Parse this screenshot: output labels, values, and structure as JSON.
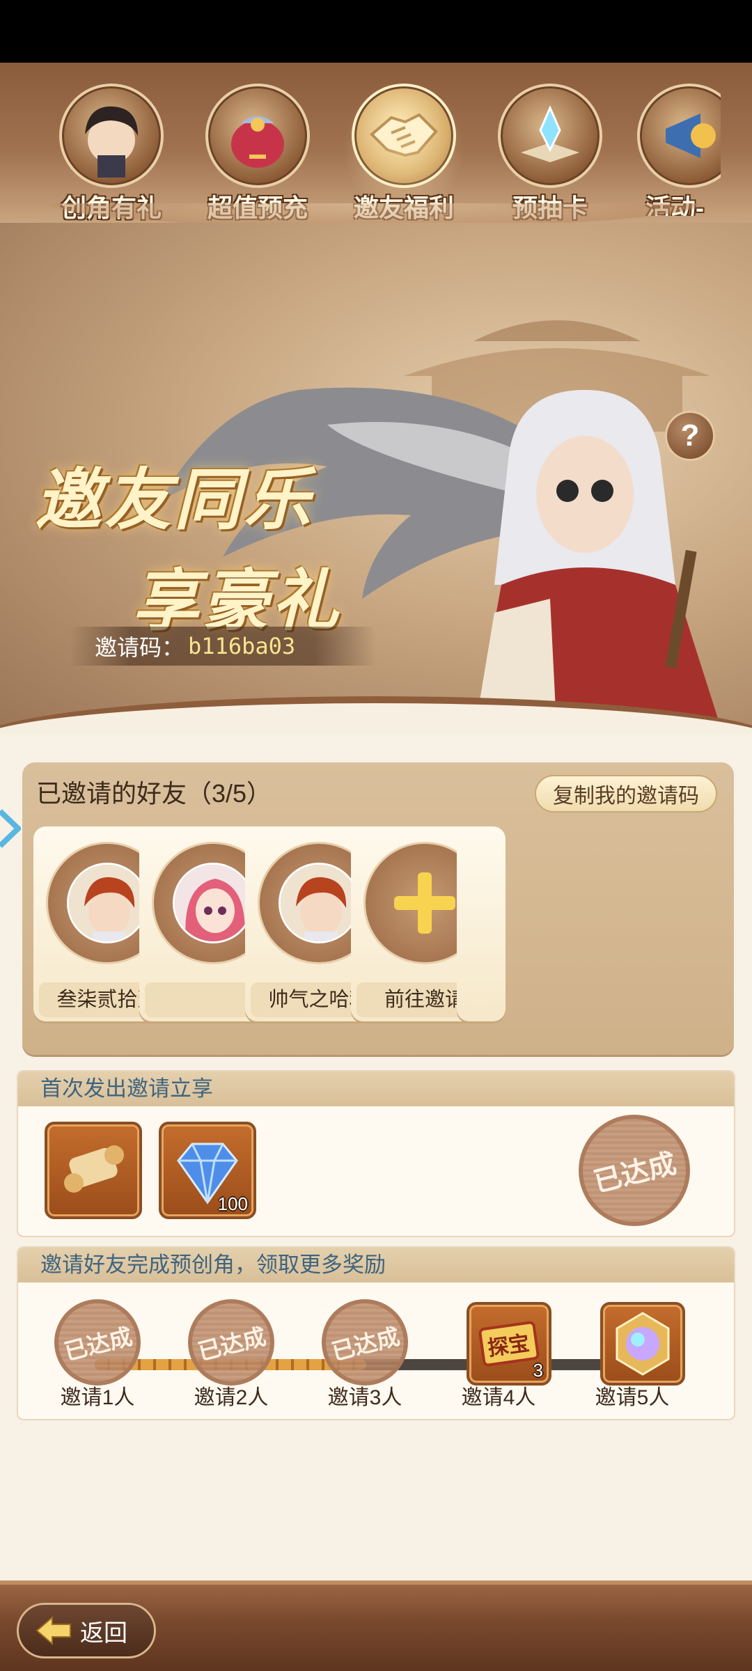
{
  "tabs": [
    {
      "label": "创角有礼",
      "icon": "character-portrait-icon"
    },
    {
      "label": "超值预充",
      "icon": "gift-bag-icon"
    },
    {
      "label": "邀友福利",
      "icon": "handshake-icon",
      "active": true
    },
    {
      "label": "预抽卡",
      "icon": "crystal-book-icon"
    },
    {
      "label": "活动-",
      "icon": "megaphone-icon"
    }
  ],
  "banner": {
    "title_line1": "邀友同乐",
    "title_line2": "享豪礼",
    "invite_code_label": "邀请码：",
    "invite_code_value": "b116ba03",
    "help_symbol": "?"
  },
  "friends": {
    "title": "已邀请的好友（3/5）",
    "copy_button": "复制我的邀请码",
    "slots": [
      {
        "name": "叁柒贰拾壹",
        "avatar": "red-hair-boy-avatar"
      },
      {
        "name": "",
        "avatar": "pink-hair-girl-avatar"
      },
      {
        "name": "帅气之哈利",
        "avatar": "red-hair-boy-avatar"
      },
      {
        "name": "前往邀请",
        "avatar": "plus-icon"
      }
    ]
  },
  "first_invite": {
    "heading": "首次发出邀请立享",
    "items": [
      {
        "icon": "scroll-icon",
        "count": ""
      },
      {
        "icon": "diamond-icon",
        "count": "100"
      }
    ],
    "stamp": "已达成"
  },
  "stages": {
    "heading": "邀请好友完成预创角，领取更多奖励",
    "progress_fraction": 0.5,
    "items": [
      {
        "label": "邀请1人",
        "status": "已达成"
      },
      {
        "label": "邀请2人",
        "status": "已达成"
      },
      {
        "label": "邀请3人",
        "status": "已达成"
      },
      {
        "label": "邀请4人",
        "reward_text": "探宝",
        "count": "3"
      },
      {
        "label": "邀请5人",
        "reward_icon": "rainbow-gem-icon"
      }
    ]
  },
  "bottom": {
    "back_label": "返回"
  }
}
